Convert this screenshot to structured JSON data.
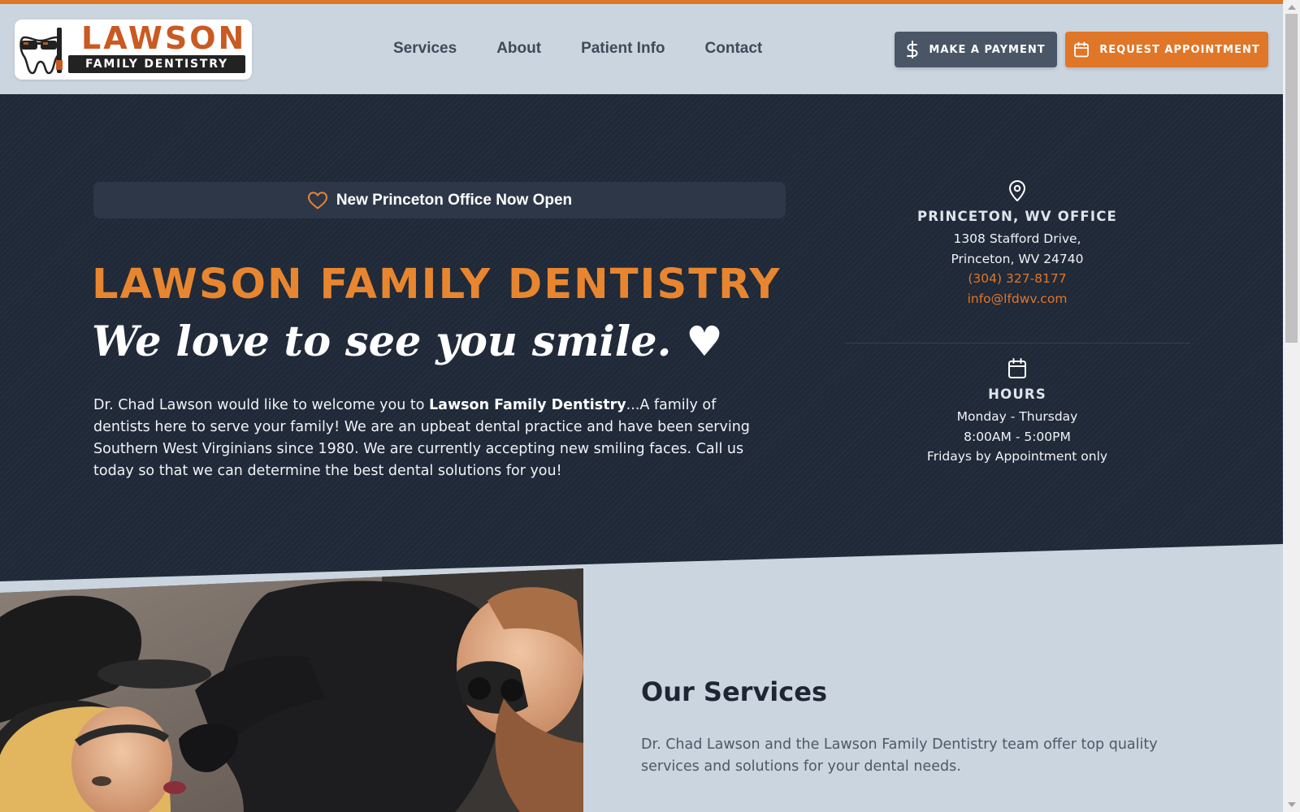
{
  "brand": {
    "logo_word": "LAWSON",
    "logo_sub": "FAMILY DENTISTRY",
    "accent_color": "#e07628",
    "dark_color": "#1f2938"
  },
  "nav": {
    "items": [
      {
        "label": "Services"
      },
      {
        "label": "About"
      },
      {
        "label": "Patient Info"
      },
      {
        "label": "Contact"
      }
    ]
  },
  "header": {
    "pay_button": {
      "label": "MAKE A PAYMENT",
      "icon": "dollar-icon"
    },
    "appointment_button": {
      "label": "REQUEST APPOINTMENT",
      "icon": "calendar-icon"
    }
  },
  "hero": {
    "announcement": {
      "label": "New Princeton Office Now Open",
      "icon": "heart-icon"
    },
    "title": "LAWSON FAMILY DENTISTRY",
    "tagline": "We love to see you smile. ♥",
    "body_intro": "Dr. Chad Lawson would like to welcome you to ",
    "body_bold": "Lawson Family Dentistry",
    "body_rest": "...A family of dentists here to serve your family! We are an upbeat dental practice and have been serving Southern West Virginians since 1980. We are currently accepting new smiling faces. Call us today so that we can determine the best dental solutions for you!"
  },
  "office": {
    "icon": "map-pin-icon",
    "heading": "PRINCETON, WV OFFICE",
    "address_line1": "1308 Stafford Drive,",
    "address_line2": "Princeton, WV 24740",
    "phone": "(304) 327-8177",
    "email": "info@lfdwv.com"
  },
  "hours": {
    "icon": "calendar-icon",
    "heading": "HOURS",
    "days": "Monday - Thursday",
    "time": "8:00AM - 5:00PM",
    "note": "Fridays by Appointment only"
  },
  "services": {
    "title": "Our Services",
    "intro": "Dr. Chad Lawson and the Lawson Family Dentistry team offer top quality services and solutions for your dental needs."
  }
}
